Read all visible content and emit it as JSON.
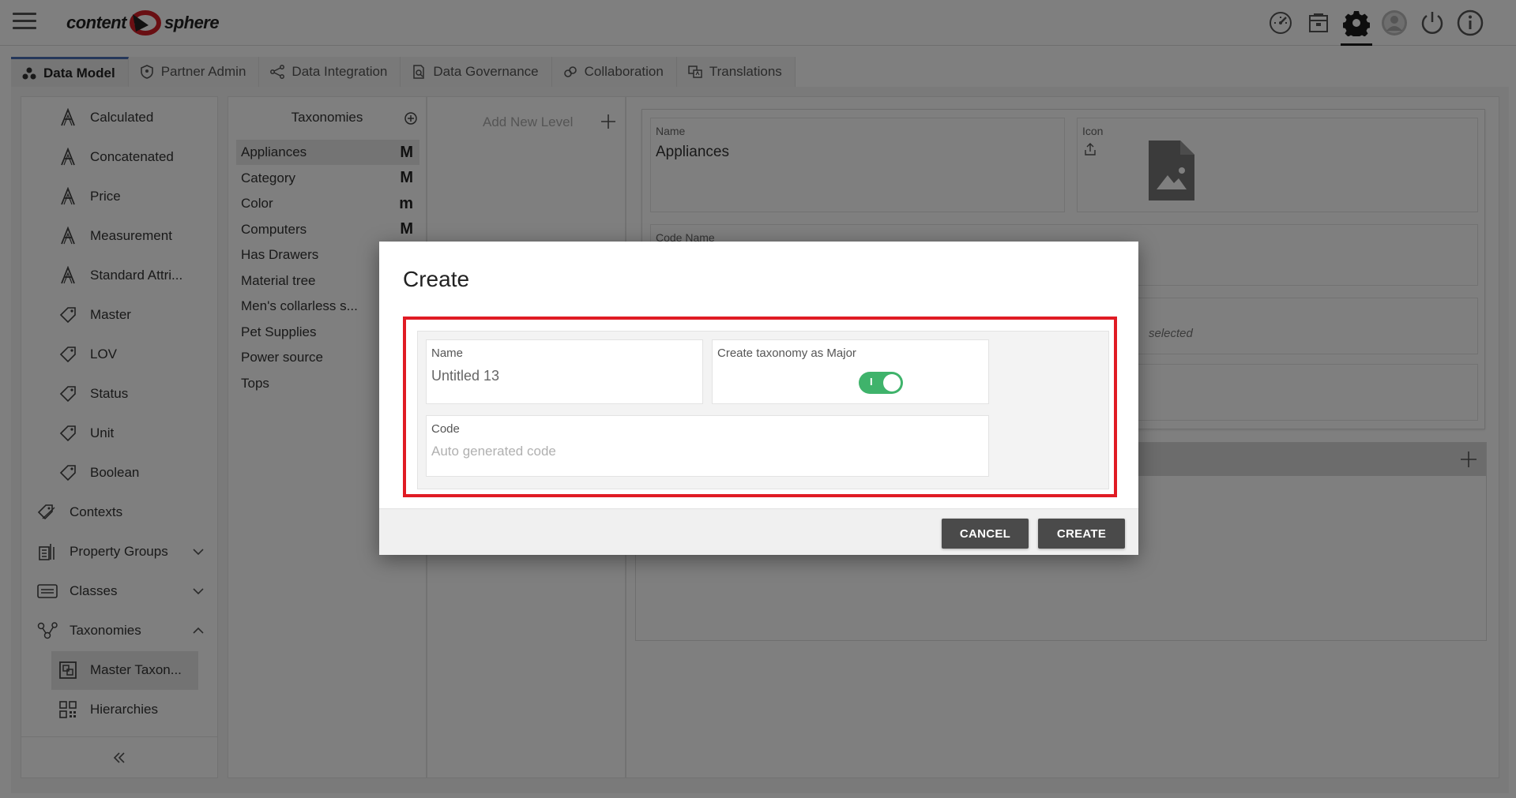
{
  "header": {
    "logo_left": "content",
    "logo_right": "sphere",
    "icons": [
      "dashboard-icon",
      "archive-icon",
      "gear-icon",
      "user-avatar-icon",
      "power-icon",
      "info-icon"
    ]
  },
  "tabs": [
    {
      "label": "Data Model",
      "icon": "data-model-icon",
      "active": true
    },
    {
      "label": "Partner Admin",
      "icon": "shield-icon"
    },
    {
      "label": "Data Integration",
      "icon": "integration-icon"
    },
    {
      "label": "Data Governance",
      "icon": "governance-icon"
    },
    {
      "label": "Collaboration",
      "icon": "collaboration-icon"
    },
    {
      "label": "Translations",
      "icon": "translations-icon"
    }
  ],
  "sidebar": {
    "items": [
      {
        "label": "Calculated",
        "icon": "attribute-a-icon"
      },
      {
        "label": "Concatenated",
        "icon": "attribute-a-icon"
      },
      {
        "label": "Price",
        "icon": "attribute-a-icon"
      },
      {
        "label": "Measurement",
        "icon": "attribute-a-icon"
      },
      {
        "label": "Standard Attri...",
        "icon": "attribute-a-icon"
      },
      {
        "label": "Master",
        "icon": "tag-icon"
      },
      {
        "label": "LOV",
        "icon": "tag-icon"
      },
      {
        "label": "Status",
        "icon": "tag-icon"
      },
      {
        "label": "Unit",
        "icon": "tag-icon"
      },
      {
        "label": "Boolean",
        "icon": "tag-icon"
      },
      {
        "label": "Contexts",
        "icon": "tags-icon"
      },
      {
        "label": "Property Groups",
        "icon": "property-groups-icon"
      },
      {
        "label": "Classes",
        "icon": "classes-icon"
      },
      {
        "label": "Taxonomies",
        "icon": "taxonomy-icon"
      },
      {
        "label": "Master Taxon...",
        "icon": "master-taxonomy-icon"
      },
      {
        "label": "Hierarchies",
        "icon": "hierarchies-icon"
      }
    ]
  },
  "taxonomies": {
    "title": "Taxonomies",
    "items": [
      {
        "label": "Appliances",
        "badge": "M"
      },
      {
        "label": "Category",
        "badge": "M"
      },
      {
        "label": "Color",
        "badge": "m"
      },
      {
        "label": "Computers",
        "badge": "M"
      },
      {
        "label": "Has Drawers",
        "badge": ""
      },
      {
        "label": "Material tree",
        "badge": ""
      },
      {
        "label": "Men's collarless s...",
        "badge": ""
      },
      {
        "label": "Pet Supplies",
        "badge": ""
      },
      {
        "label": "Power source",
        "badge": ""
      },
      {
        "label": "Tops",
        "badge": ""
      }
    ]
  },
  "levels": {
    "add_label": "Add New Level"
  },
  "details": {
    "name_label": "Name",
    "name_value": "Appliances",
    "icon_label": "Icon",
    "code_name_label": "Code Name",
    "selected_fragment": "selected"
  },
  "modal": {
    "title": "Create",
    "name_label": "Name",
    "name_value": "Untitled 13",
    "major_label": "Create taxonomy as Major",
    "major_toggle_on": true,
    "toggle_mark": "I",
    "code_label": "Code",
    "code_placeholder": "Auto generated code",
    "cancel_label": "CANCEL",
    "create_label": "CREATE"
  }
}
